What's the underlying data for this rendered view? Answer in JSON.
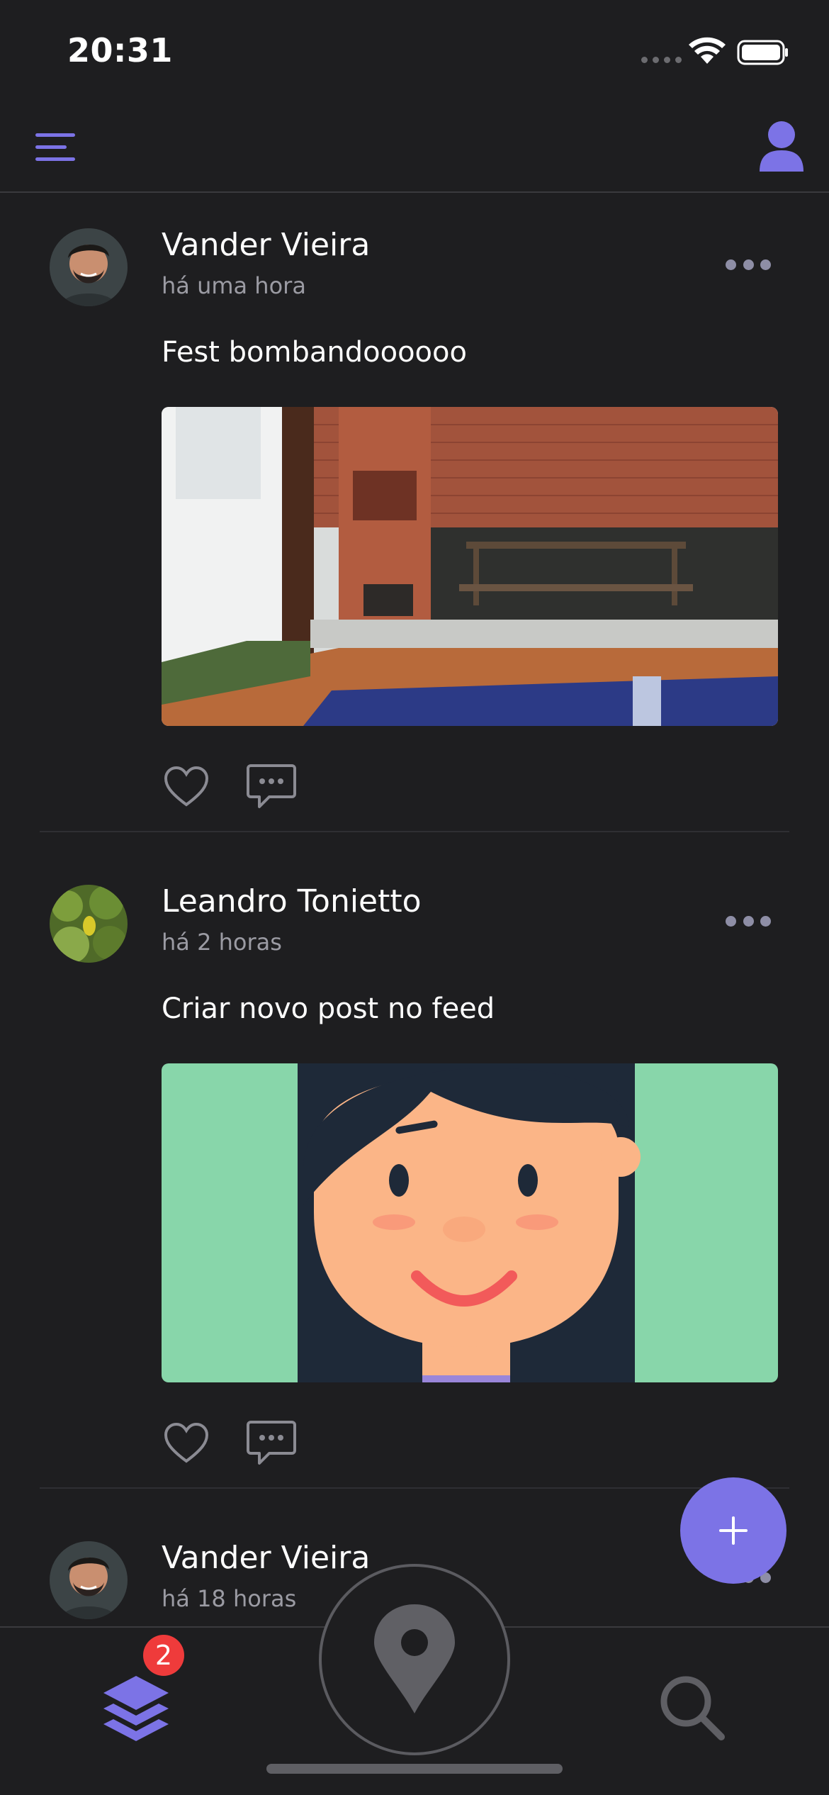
{
  "status_bar": {
    "time": "20:31"
  },
  "colors": {
    "accent": "#7c73e6",
    "background": "#1e1e20",
    "badge": "#ef3b3b",
    "muted_text": "#9b9ba3"
  },
  "posts": [
    {
      "author": "Vander Vieira",
      "time_ago": "há uma hora",
      "caption": "Fest bombandoooooo",
      "image": "patio-with-brick-barbecue-and-pool"
    },
    {
      "author": "Leandro Tonietto",
      "time_ago": "há 2 horas",
      "caption": "Criar novo post no feed",
      "image": "cartoon-girl-face"
    },
    {
      "author": "Vander Vieira",
      "time_ago": "há 18 horas"
    }
  ],
  "bottom_nav": {
    "feed_badge": "2",
    "icons": [
      "layers-icon",
      "location-pin-icon",
      "search-icon"
    ]
  },
  "fab": {
    "icon": "plus-icon"
  }
}
